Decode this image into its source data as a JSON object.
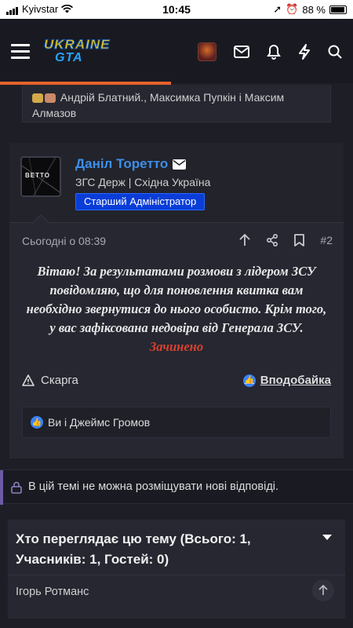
{
  "status_bar": {
    "carrier": "Kyivstar",
    "time": "10:45",
    "battery": "88 %"
  },
  "header": {
    "logo_line1": "UKRAINE",
    "logo_line2": "GTA",
    "icons": [
      "menu-icon",
      "user-avatar",
      "mail-icon",
      "bell-icon",
      "bolt-icon",
      "search-icon"
    ]
  },
  "previous_post": {
    "likes_text": "Андрій Блатний., Максимка Пупкін і Максим Алмазов"
  },
  "post": {
    "author": "Даніл Торетто",
    "avatar_text": "ВЕТТО",
    "author_info": "ЗГС Держ | Східна Україна",
    "role": "Старший Адміністратор",
    "date": "Сьогодні о 08:39",
    "number": "#2",
    "body": "Вітаю! За результатами розмови з лідером ЗСУ повідомляю, що для поновлення квитка вам необхідно звернутися до нього особисто. Крім того, у вас зафіксована недовіра від Генерала ЗСУ.",
    "closed_label": "Зачинено",
    "report_label": "Скарга",
    "like_label": "Вподобайка",
    "likes_text": "Ви і Джеймс Громов",
    "colors": {
      "author": "#3d8fe8",
      "role_badge": "#0a3dd8",
      "closed": "#d9402e",
      "accent": "#e7622c"
    }
  },
  "notice": {
    "text": "В цій темі не можна розміщувати нові відповіді."
  },
  "viewers": {
    "title": "Хто переглядає цю тему (Всього: 1, Учасників: 1, Гостей: 0)",
    "names": "Ігорь Ротманс"
  }
}
